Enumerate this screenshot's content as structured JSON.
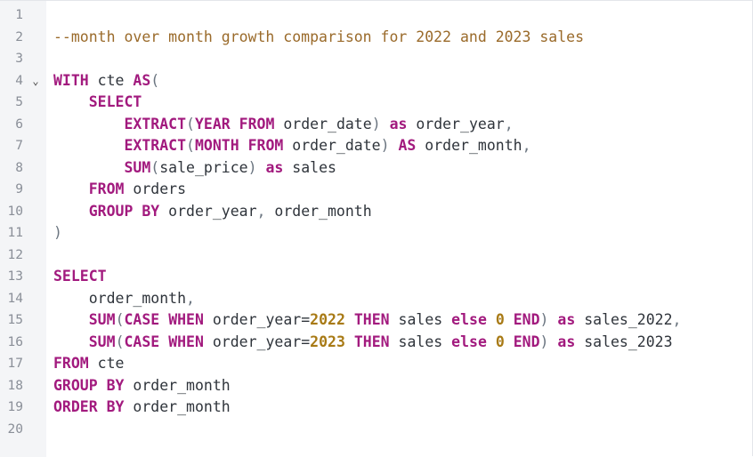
{
  "editor": {
    "lines": [
      {
        "num": "1",
        "code": ""
      },
      {
        "num": "2",
        "code": "--month over month growth comparison for 2022 and 2023 sales"
      },
      {
        "num": "3",
        "code": ""
      },
      {
        "num": "4",
        "code": "WITH cte AS(",
        "fold": "chevron-down"
      },
      {
        "num": "5",
        "code": "    SELECT"
      },
      {
        "num": "6",
        "code": "        EXTRACT(YEAR FROM order_date) as order_year,"
      },
      {
        "num": "7",
        "code": "        EXTRACT(MONTH FROM order_date) AS order_month,"
      },
      {
        "num": "8",
        "code": "        SUM(sale_price) as sales"
      },
      {
        "num": "9",
        "code": "    FROM orders"
      },
      {
        "num": "10",
        "code": "    GROUP BY order_year, order_month"
      },
      {
        "num": "11",
        "code": ")"
      },
      {
        "num": "12",
        "code": ""
      },
      {
        "num": "13",
        "code": "SELECT"
      },
      {
        "num": "14",
        "code": "    order_month,"
      },
      {
        "num": "15",
        "code": "    SUM(CASE WHEN order_year=2022 THEN sales else 0 END) as sales_2022,"
      },
      {
        "num": "16",
        "code": "    SUM(CASE WHEN order_year=2023 THEN sales else 0 END) as sales_2023"
      },
      {
        "num": "17",
        "code": "FROM cte"
      },
      {
        "num": "18",
        "code": "GROUP BY order_month"
      },
      {
        "num": "19",
        "code": "ORDER BY order_month"
      },
      {
        "num": "20",
        "code": ""
      }
    ],
    "fold_icon": "⌄",
    "colors": {
      "keyword": "#a21a7e",
      "comment": "#9a6a2a",
      "number": "#a87a15",
      "text": "#2f343b",
      "line_number": "#8a8f98",
      "gutter_bg": "#f4f5f7"
    }
  }
}
